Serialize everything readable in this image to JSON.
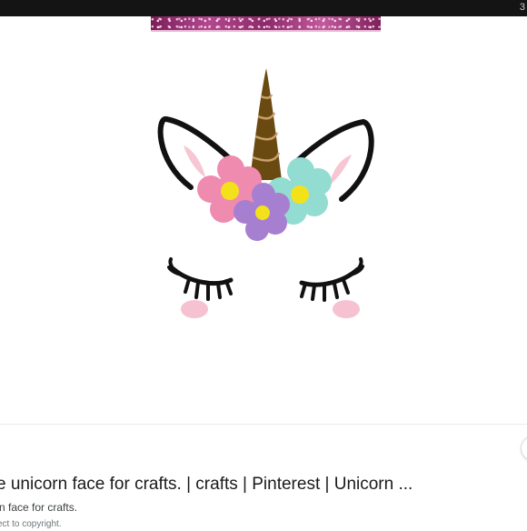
{
  "viewer": {
    "corner_glyph": "3"
  },
  "image": {
    "subject": "unicorn-face-printable",
    "colors": {
      "glitter": "#b2488f",
      "horn": "#6b4a12",
      "ear_outline": "#111111",
      "ear_inner": "#f6c6d3",
      "flower_pink": "#f08bb0",
      "flower_mint": "#93dcd2",
      "flower_purple": "#a77fd0",
      "flower_center": "#f3e21a",
      "lashes": "#111111",
      "cheeks": "#f6c2d1"
    }
  },
  "result": {
    "title": "e unicorn face for crafts. | crafts | Pinterest | Unicorn ...",
    "caption": "n face for crafts.",
    "notice": "ect to copyright."
  }
}
